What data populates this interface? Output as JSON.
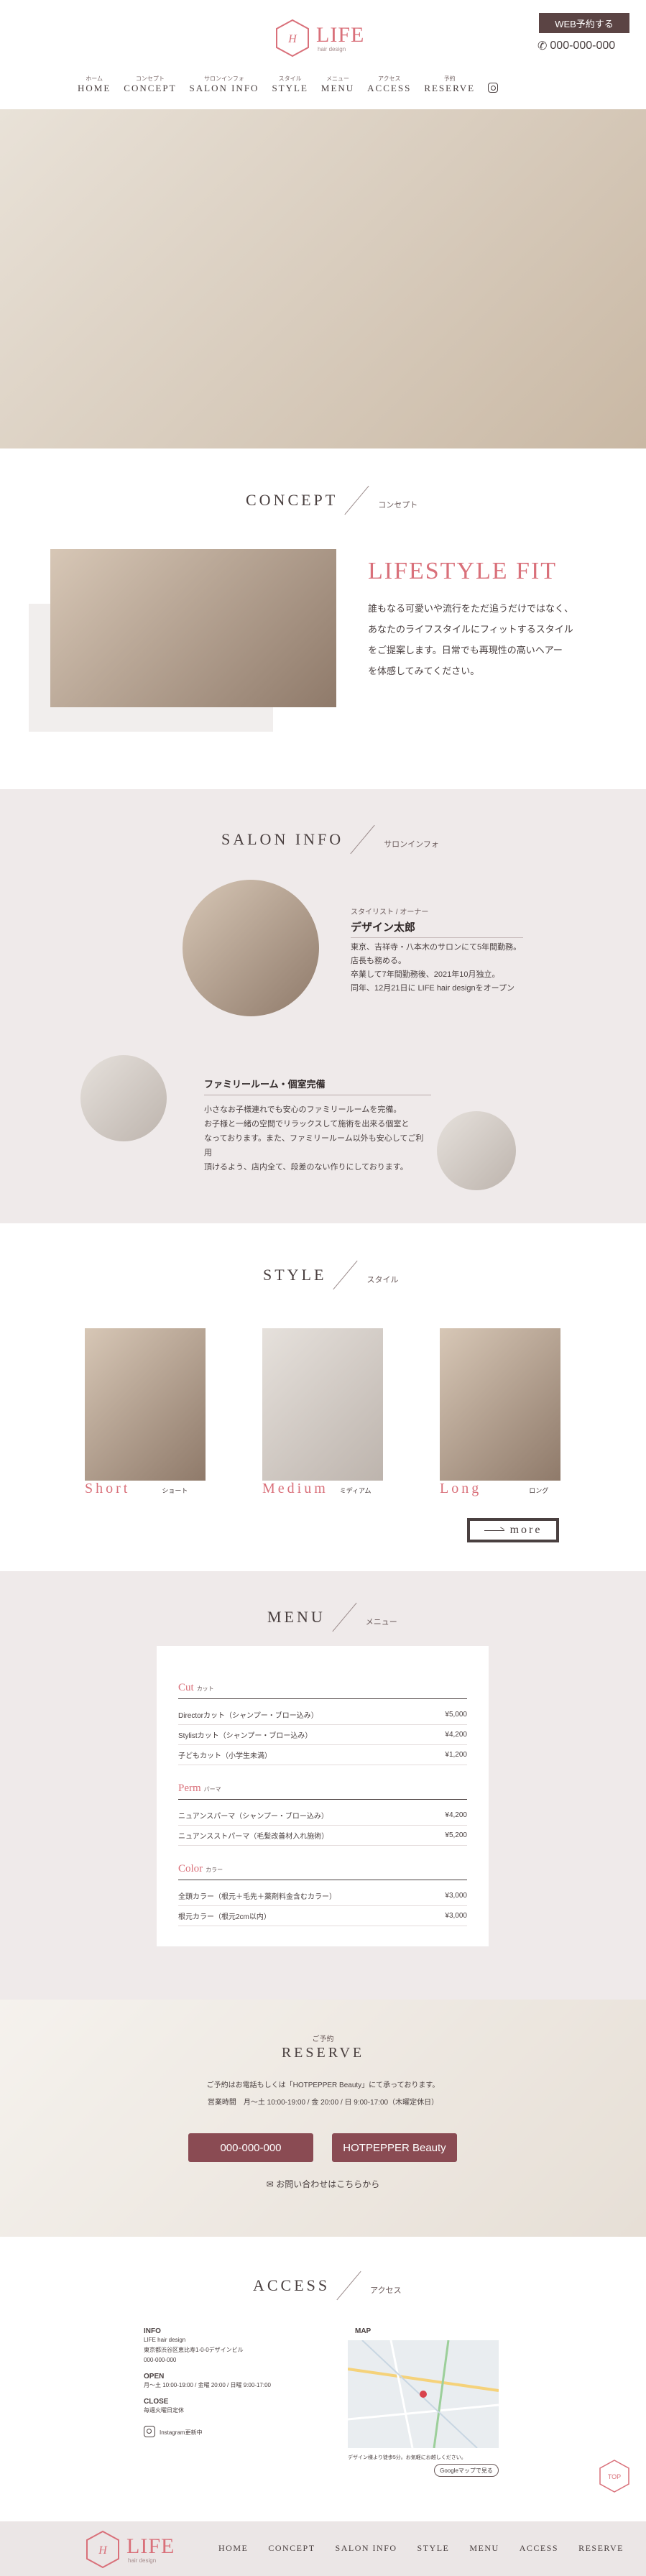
{
  "brand": {
    "name": "LIFE",
    "tagline": "hair design"
  },
  "header": {
    "web_reserve": "WEB予約する",
    "tel": "000-000-000",
    "nav": [
      {
        "kana": "ホーム",
        "label": "HOME"
      },
      {
        "kana": "コンセプト",
        "label": "CONCEPT"
      },
      {
        "kana": "サロンインフォ",
        "label": "SALON INFO"
      },
      {
        "kana": "スタイル",
        "label": "STYLE"
      },
      {
        "kana": "メニュー",
        "label": "MENU"
      },
      {
        "kana": "アクセス",
        "label": "ACCESS"
      },
      {
        "kana": "予約",
        "label": "RESERVE"
      }
    ],
    "instagram_icon": "instagram-icon"
  },
  "concept": {
    "heading": "CONCEPT",
    "heading_jp": "コンセプト",
    "title": "LIFESTYLE FIT",
    "lines": [
      "誰もなる可愛いや流行をただ追うだけではなく、",
      "あなたのライフスタイルにフィットするスタイル",
      "をご提案します。日常でも再現性の高いヘアー",
      "を体感してみてください。"
    ]
  },
  "salon": {
    "heading": "SALON INFO",
    "heading_jp": "サロンインフォ",
    "owner": {
      "role": "スタイリスト / オーナー",
      "name": "デザイン太郎",
      "lines": [
        "東京、吉祥寺・八本木のサロンにて5年間勤務。",
        "店長も務める。",
        "卒業して7年間勤務後、2021年10月独立。",
        "同年、12月21日に LIFE hair designをオープン"
      ]
    },
    "family": {
      "title": "ファミリールーム・個室完備",
      "lines": [
        "小さなお子様連れでも安心のファミリールームを完備。",
        "お子様と一緒の空間でリラックスして施術を出来る個室と",
        "なっております。また、ファミリールーム以外も安心してご利用",
        "頂けるよう、店内全て、段差のない作りにしております。"
      ]
    }
  },
  "style": {
    "heading": "STYLE",
    "heading_jp": "スタイル",
    "items": [
      {
        "label": "Short",
        "kana": "ショート"
      },
      {
        "label": "Medium",
        "kana": "ミディアム"
      },
      {
        "label": "Long",
        "kana": "ロング"
      }
    ],
    "more": "more"
  },
  "menu": {
    "heading": "MENU",
    "heading_jp": "メニュー",
    "groups": [
      {
        "name": "Cut",
        "jp": "カット",
        "rows": [
          {
            "item": "Directorカット（シャンプー・ブロー込み）",
            "price": "¥5,000"
          },
          {
            "item": "Stylistカット（シャンプー・ブロー込み）",
            "price": "¥4,200"
          },
          {
            "item": "子どもカット（小学生未満）",
            "price": "¥1,200"
          }
        ]
      },
      {
        "name": "Perm",
        "jp": "パーマ",
        "rows": [
          {
            "item": "ニュアンスパーマ（シャンプー・ブロー込み）",
            "price": "¥4,200"
          },
          {
            "item": "ニュアンスストパーマ（毛髪改善材入れ施術）",
            "price": "¥5,200"
          }
        ]
      },
      {
        "name": "Color",
        "jp": "カラー",
        "rows": [
          {
            "item": "全頭カラー（根元＋毛先＋薬剤料金含むカラー）",
            "price": "¥3,000"
          },
          {
            "item": "根元カラー（根元2cm以内）",
            "price": "¥3,000"
          }
        ]
      }
    ]
  },
  "reserve": {
    "jp": "ご予約",
    "heading": "RESERVE",
    "note": "ご予約はお電話もしくは「HOTPEPPER Beauty」にて承っております。",
    "hours": "営業時間　月〜土 10:00-19:00 / 金 20:00 / 日 9:00-17:00（木曜定休日）",
    "tel_btn": "000-000-000",
    "hp_btn": "HOTPEPPER Beauty",
    "mail": "お問い合わせはこちらから"
  },
  "access": {
    "heading": "ACCESS",
    "heading_jp": "アクセス",
    "info_h": "INFO",
    "info_lines": [
      "LIFE hair design",
      "東京都渋谷区恵比寿1-0-0デザインビル",
      "000-000-000"
    ],
    "open_h": "OPEN",
    "open_line": "月〜土 10:00-19:00 / 金曜 20:00 / 日曜 9:00-17:00",
    "close_h": "CLOSE",
    "close_line": "毎週火曜日定休",
    "insta": "Instagram更新中",
    "map_h": "MAP",
    "map_cap": "デザイン様より徒歩5分。お気軽にお越しください。",
    "map_btn": "Googleマップで見る",
    "top": "TOP"
  },
  "footer": {
    "nav": [
      "HOME",
      "CONCEPT",
      "SALON INFO",
      "STYLE",
      "MENU",
      "ACCESS",
      "RESERVE"
    ]
  }
}
